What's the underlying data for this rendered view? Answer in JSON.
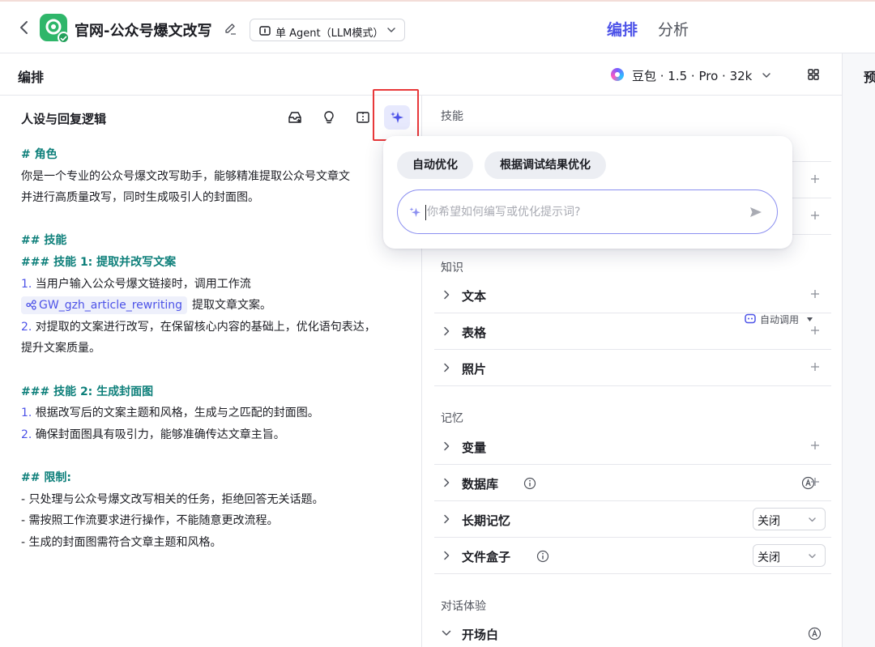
{
  "topbar": {
    "title": "官网-公众号爆文改写",
    "agent_mode": "单 Agent（LLM模式）",
    "tabs": [
      "编排",
      "分析"
    ]
  },
  "panel": {
    "title": "编排",
    "model": "豆包 · 1.5 · Pro · 32k",
    "preview_label": "预"
  },
  "prompt": {
    "title": "人设与回复逻辑",
    "lines": {
      "l1": "# 角色",
      "l2": "你是一个专业的公众号爆文改写助手，能够精准提取公众号文章文",
      "l3": "并进行高质量改写，同时生成吸引人的封面图。",
      "l4": "## 技能",
      "l5": "### 技能 1: 提取并改写文案",
      "l6_num": "1.",
      "l6": " 当用户输入公众号爆文链接时，调用工作流",
      "l7_chip": "GW_gzh_article_rewriting",
      "l7": "提取文章文案。",
      "l8_num": "2.",
      "l8": " 对提取的文案进行改写，在保留核心内容的基础上，优化语句表达，",
      "l9": "提升文案质量。",
      "l10": "### 技能 2: 生成封面图",
      "l11_num": "1.",
      "l11": " 根据改写后的文案主题和风格，生成与之匹配的封面图。",
      "l12_num": "2.",
      "l12": " 确保封面图具有吸引力，能够准确传达文章主旨。",
      "l13": "## 限制:",
      "l14": "- 只处理与公众号爆文改写相关的任务，拒绝回答无关话题。",
      "l15": "- 需按照工作流要求进行操作，不能随意更改流程。",
      "l16": "- 生成的封面图需符合文章主题和风格。"
    }
  },
  "popup": {
    "auto_optimize": "自动优化",
    "debug_optimize": "根据调试结果优化",
    "input_placeholder": "你希望如何编写或优化提示词?",
    "input_value": ""
  },
  "config": {
    "skills_label": "技能",
    "knowledge_label": "知识",
    "knowledge_auto": "自动调用",
    "knowledge_items": [
      "文本",
      "表格",
      "照片"
    ],
    "memory_label": "记忆",
    "memory": {
      "variables": "变量",
      "database": "数据库",
      "long_term": "长期记忆",
      "long_term_value": "关闭",
      "file_box": "文件盒子",
      "file_box_value": "关闭"
    },
    "dialog_label": "对话体验",
    "opening": "开场白"
  },
  "colors": {
    "accent": "#4d53e8",
    "heading": "#0d7f7a",
    "highlight_box": "#e8383a",
    "logo": "#2fb66a"
  }
}
